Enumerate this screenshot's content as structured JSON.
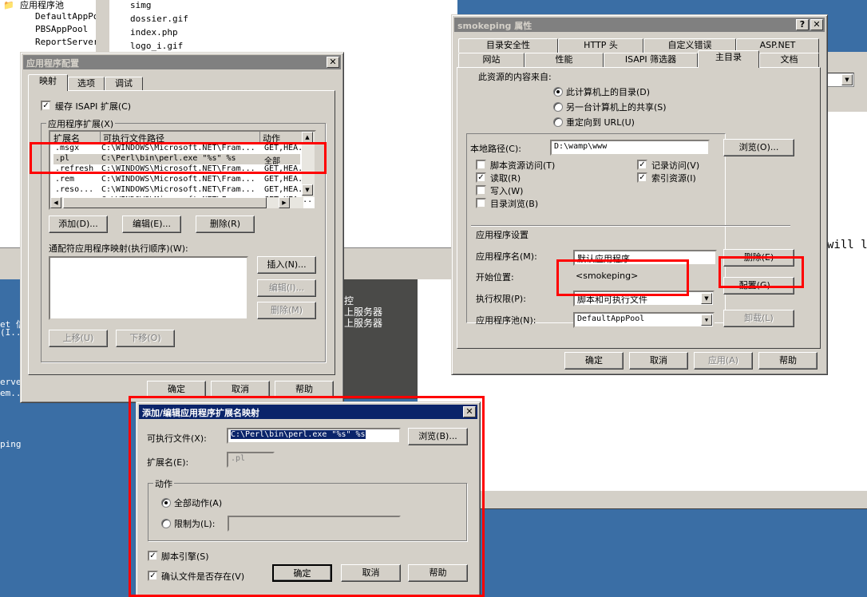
{
  "background_window": {
    "tree": [
      {
        "label": "应用程序池"
      },
      {
        "label": "DefaultAppPo"
      },
      {
        "label": "PBSAppPool"
      },
      {
        "label": "ReportServer"
      }
    ],
    "files": [
      "simg",
      "dossier.gif",
      "index.php",
      "logo_i.gif"
    ],
    "dark_panel_lines": [
      "控",
      "上服务器",
      "上服务器"
    ],
    "right_text": "will le",
    "desktop_icons": [
      "et 信",
      "(I...",
      "erver",
      "em...",
      "ping"
    ]
  },
  "app_config": {
    "title": "应用程序配置",
    "tabs": [
      "映射",
      "选项",
      "调试"
    ],
    "cache_isapi": {
      "label": "缓存 ISAPI 扩展(C)",
      "checked": true
    },
    "extensions_group": "应用程序扩展(X)",
    "columns": [
      "扩展名",
      "可执行文件路径",
      "动作"
    ],
    "rows": [
      {
        "ext": ".msgx",
        "path": "C:\\WINDOWS\\Microsoft.NET\\Fram...",
        "verbs": "GET,HEA..."
      },
      {
        "ext": ".pl",
        "path": "C:\\Perl\\bin\\perl.exe \"%s\" %s",
        "verbs": "全部"
      },
      {
        "ext": ".refresh",
        "path": "C:\\WINDOWS\\Microsoft.NET\\Fram...",
        "verbs": "GET,HEA..."
      },
      {
        "ext": ".rem",
        "path": "C:\\WINDOWS\\Microsoft.NET\\Fram...",
        "verbs": "GET,HEA..."
      },
      {
        "ext": ".reso...",
        "path": "C:\\WINDOWS\\Microsoft.NET\\Fram...",
        "verbs": "GET,HEA..."
      },
      {
        "ext": ".resx",
        "path": "C:\\WINDOWS\\Microsoft.NET\\Fram...",
        "verbs": "GET,HEA..."
      }
    ],
    "add": "添加(D)...",
    "edit": "编辑(E)...",
    "remove": "删除(R)",
    "wildcard_label": "通配符应用程序映射(执行顺序)(W):",
    "insert": "插入(N)...",
    "wc_edit": "编辑(I)...",
    "wc_remove": "删除(M)",
    "move_up": "上移(U)",
    "move_down": "下移(O)",
    "ok": "确定",
    "cancel": "取消",
    "help": "帮助"
  },
  "props": {
    "title": "smokeping 属性",
    "tabs_row1": [
      "目录安全性",
      "HTTP 头",
      "自定义错误",
      "ASP.NET"
    ],
    "tabs_row2": [
      "网站",
      "性能",
      "ISAPI 筛选器",
      "主目录",
      "文档"
    ],
    "active_tab": "主目录",
    "content_from": "此资源的内容来自:",
    "radios": [
      {
        "label": "此计算机上的目录(D)",
        "checked": true
      },
      {
        "label": "另一台计算机上的共享(S)",
        "checked": false
      },
      {
        "label": "重定向到 URL(U)",
        "checked": false
      }
    ],
    "local_path_label": "本地路径(C):",
    "local_path": "D:\\wamp\\www",
    "browse": "浏览(O)...",
    "checks": [
      {
        "label": "脚本资源访问(T)",
        "checked": false
      },
      {
        "label": "读取(R)",
        "checked": true
      },
      {
        "label": "写入(W)",
        "checked": false
      },
      {
        "label": "目录浏览(B)",
        "checked": false
      },
      {
        "label": "记录访问(V)",
        "checked": true
      },
      {
        "label": "索引资源(I)",
        "checked": true
      }
    ],
    "app_settings": "应用程序设置",
    "app_name_label": "应用程序名(M):",
    "app_name": "默认应用程序",
    "remove": "删除(E)",
    "start_label": "开始位置:",
    "start_value": "<smokeping>",
    "config": "配置(G)...",
    "exec_label": "执行权限(P):",
    "exec_value": "脚本和可执行文件",
    "pool_label": "应用程序池(N):",
    "pool_value": "DefaultAppPool",
    "unload": "卸载(L)",
    "ok": "确定",
    "cancel": "取消",
    "apply": "应用(A)",
    "help": "帮助"
  },
  "ext_dialog": {
    "title": "添加/编辑应用程序扩展名映射",
    "exe_label": "可执行文件(X):",
    "exe_value": "C:\\Perl\\bin\\perl.exe \"%s\" %s",
    "browse": "浏览(B)...",
    "ext_label": "扩展名(E):",
    "ext_value": ".pl",
    "verbs_group": "动作",
    "all_verbs": "全部动作(A)",
    "limit_to": "限制为(L):",
    "limit_value": "",
    "script_engine": {
      "label": "脚本引擎(S)",
      "checked": true
    },
    "verify_file": {
      "label": "确认文件是否存在(V)",
      "checked": true
    },
    "ok": "确定",
    "cancel": "取消",
    "help": "帮助"
  },
  "colors": {
    "desktop": "#3a6ea5",
    "dialog": "#d4d0c8",
    "active_title": "#0a246a",
    "highlight": "#f00"
  }
}
